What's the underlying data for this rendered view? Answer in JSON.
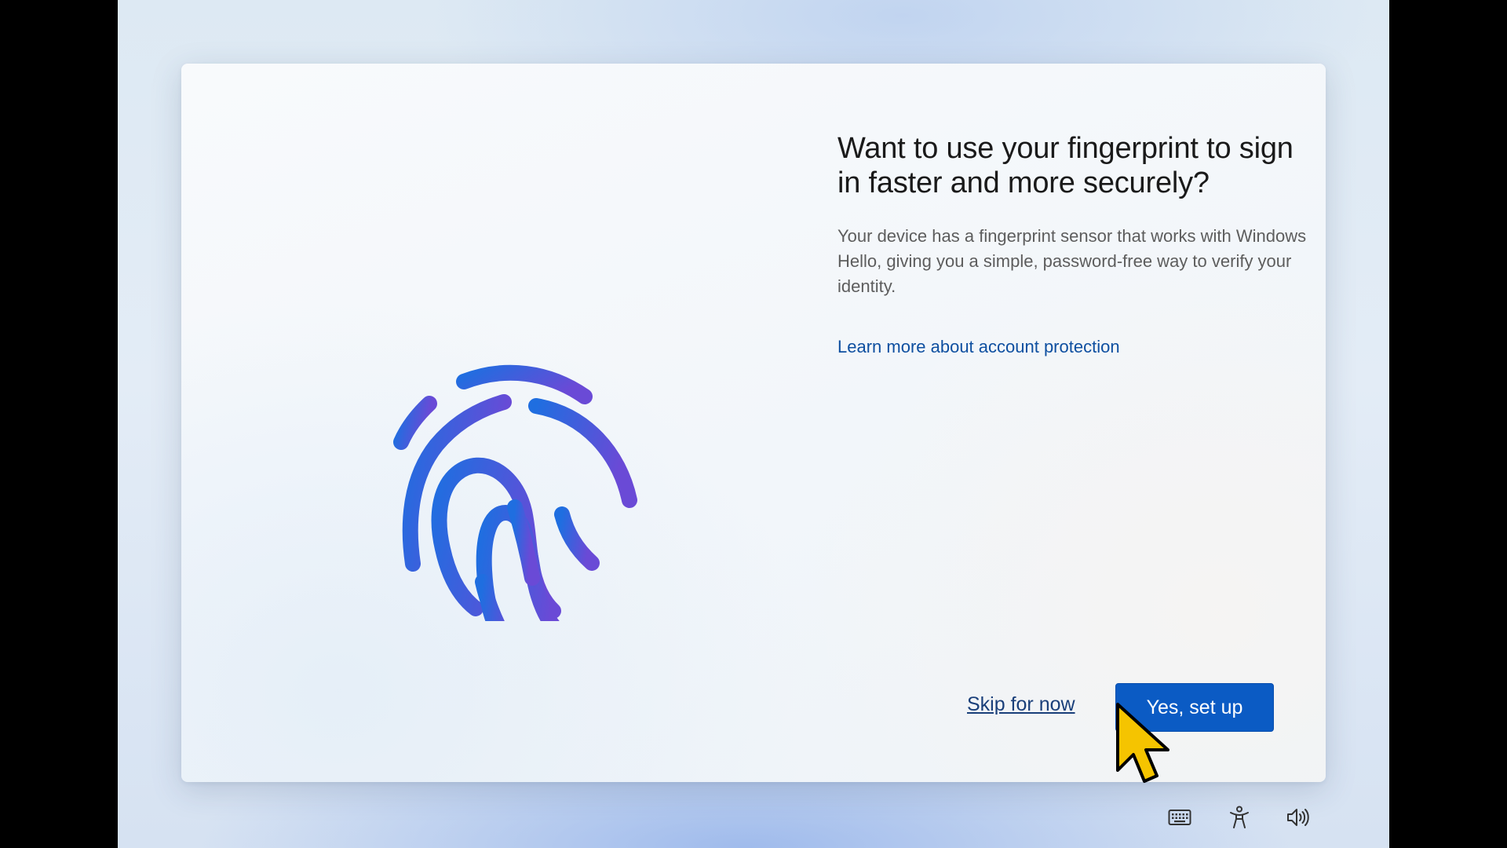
{
  "dialog": {
    "title": "Want to use your fingerprint to sign in faster and more securely?",
    "description": "Your device has a fingerprint sensor that works with Windows Hello, giving you a simple, password-free way to verify your identity.",
    "learn_more_link": "Learn more about account protection",
    "skip_label": "Skip for now",
    "setup_label": "Yes, set up"
  },
  "illustration": {
    "icon": "fingerprint-icon"
  },
  "tray": {
    "icons": [
      "keyboard-icon",
      "accessibility-icon",
      "volume-icon"
    ]
  },
  "colors": {
    "primary_button": "#0b5bc4",
    "link": "#0e4fa0",
    "fingerprint_start": "#1f6ee0",
    "fingerprint_end": "#6a4ad6"
  }
}
